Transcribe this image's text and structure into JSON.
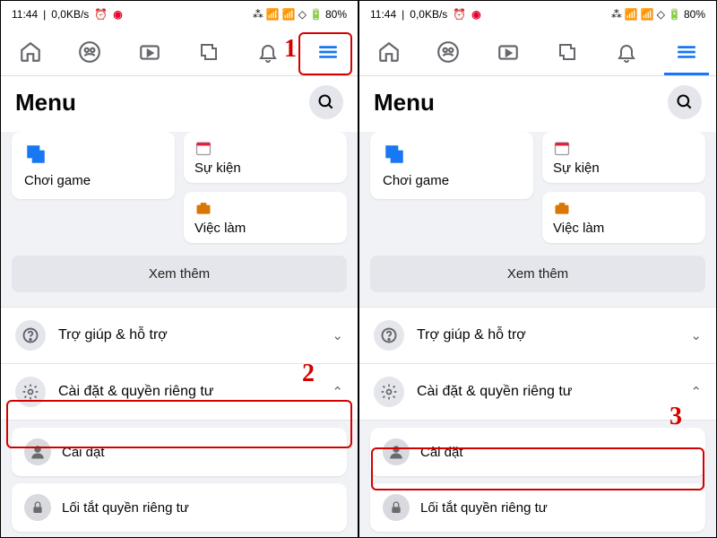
{
  "status": {
    "time": "11:44",
    "speed": "0,0KB/s",
    "battery": "80%"
  },
  "menu": {
    "title": "Menu",
    "cards": {
      "gaming": "Chơi game",
      "events": "Sự kiện",
      "jobs": "Việc làm"
    },
    "see_more": "Xem thêm",
    "sections": {
      "help": "Trợ giúp & hỗ trợ",
      "settings_privacy": "Cài đặt & quyền riêng tư"
    },
    "subitems": {
      "settings": "Cài đặt",
      "privacy_shortcuts": "Lối tắt quyền riêng tư"
    }
  },
  "annotations": {
    "one": "1",
    "two": "2",
    "three": "3"
  }
}
